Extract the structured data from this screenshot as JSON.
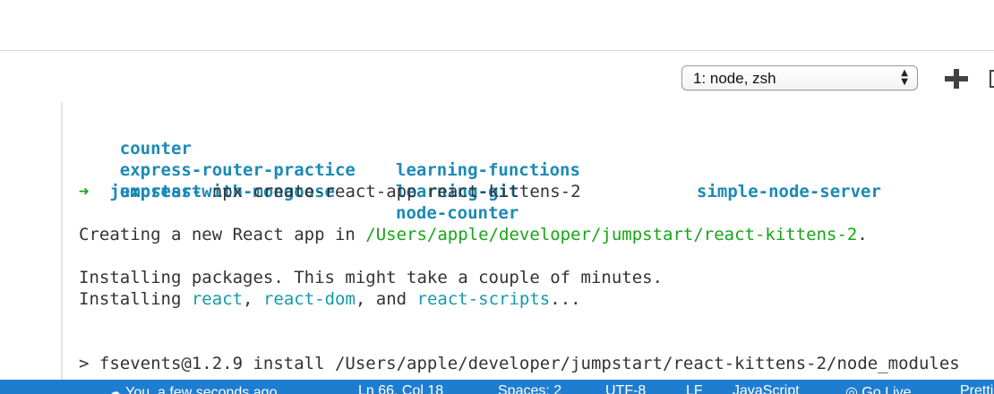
{
  "terminal_selector": {
    "value": "1: node, zsh",
    "arrows": "▲▼"
  },
  "terminal": {
    "dirs": [
      [
        "counter",
        "learning-functions",
        "simple-node-server"
      ],
      [
        "express-router-practice",
        "learning-git",
        ""
      ],
      [
        "express-with-mongoose",
        "node-counter",
        ""
      ]
    ],
    "prompt_arrow": "➜",
    "prompt_dir": "jumpstart",
    "command": "npx create-react-app react-kittens-2",
    "creating_prefix": "Creating a new React app in ",
    "creating_path": "/Users/apple/developer/jumpstart/react-kittens-2",
    "creating_suffix": ".",
    "installing_line": "Installing packages. This might take a couple of minutes.",
    "installing_prefix": "Installing ",
    "pkg1": "react",
    "sep1": ", ",
    "pkg2": "react-dom",
    "sep2": ", and ",
    "pkg3": "react-scripts",
    "installing_suffix": "...",
    "fsevents_line": "> fsevents@1.2.9 install /Users/apple/developer/jumpstart/react-kittens-2/node_modules"
  },
  "status_bar": {
    "live_share": "You, a few seconds ago",
    "position": "Ln 66, Col 18",
    "spaces": "Spaces: 2",
    "encoding": "UTF-8",
    "eol": "LF",
    "language": "JavaScript",
    "go_live": "Go Live",
    "prettier": "Prettier"
  }
}
